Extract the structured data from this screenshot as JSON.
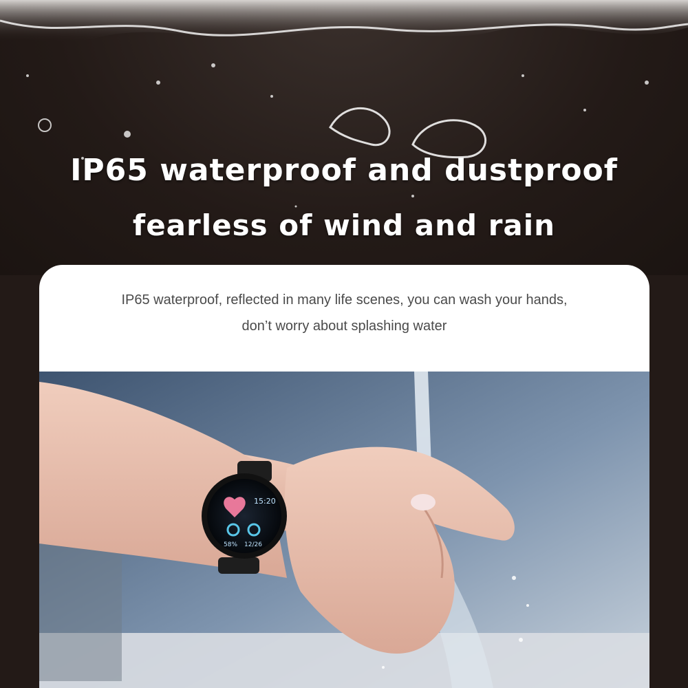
{
  "banner": {
    "headline_line1": "IP65 waterproof and dustproof",
    "headline_line2": "fearless of wind and rain"
  },
  "card": {
    "description_line1": "IP65 waterproof, reflected in many life scenes, you can wash your hands,",
    "description_line2": "don’t worry about splashing water"
  },
  "watch": {
    "time": "15:20",
    "steps": "58%",
    "date": "12/26"
  },
  "colors": {
    "background": "#231a17",
    "card": "#ffffff",
    "headline": "#ffffff",
    "description": "#4a4a4a",
    "heart": "#e8789a"
  }
}
